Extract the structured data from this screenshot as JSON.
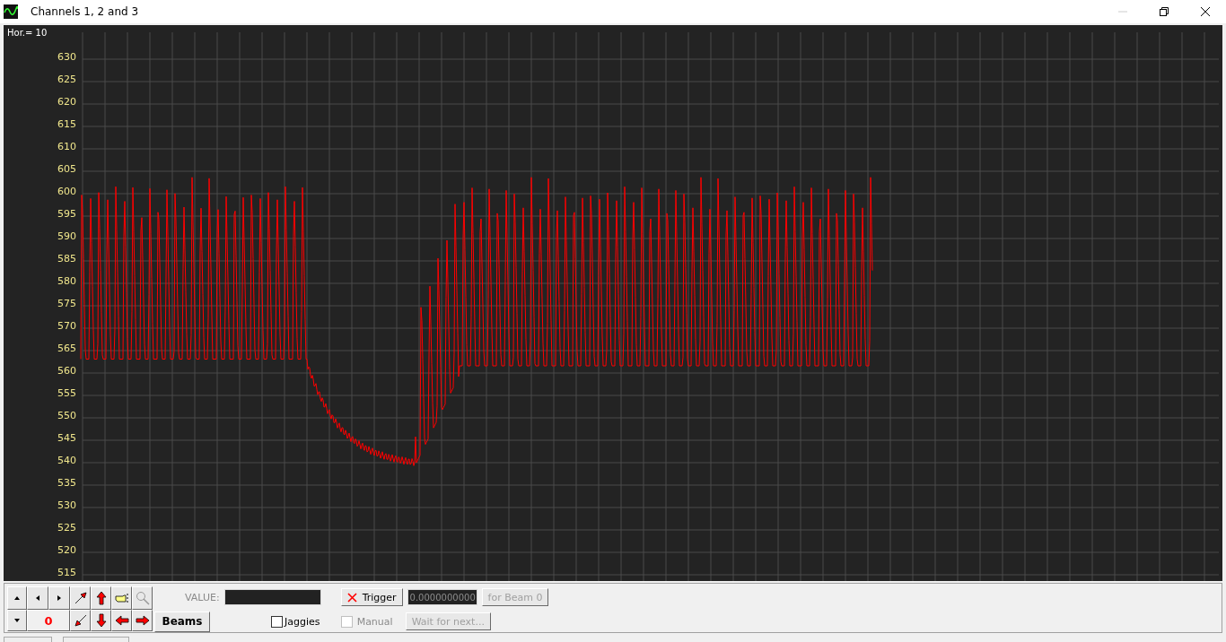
{
  "window": {
    "title": "Channels 1, 2 and 3"
  },
  "plot": {
    "scale_label": "Hor.=  10",
    "y_labels": [
      "630",
      "625",
      "620",
      "615",
      "610",
      "605",
      "600",
      "595",
      "590",
      "585",
      "580",
      "575",
      "570",
      "565",
      "560",
      "555",
      "550",
      "545",
      "540",
      "535",
      "530",
      "525",
      "520",
      "515"
    ]
  },
  "toolbar": {
    "position_value": "0",
    "beams_button": "Beams",
    "value_label": "VALUE:",
    "jaggies": {
      "label": "Jaggies",
      "checked": false
    },
    "trigger_button": "Trigger",
    "trigger_value": "0.0000000000",
    "beam_button": {
      "label": "for Beam 0",
      "disabled": true
    },
    "manual": {
      "label": "Manual",
      "checked": false,
      "disabled": true
    },
    "wait_button": {
      "label": "Wait for next...",
      "disabled": true
    }
  }
}
